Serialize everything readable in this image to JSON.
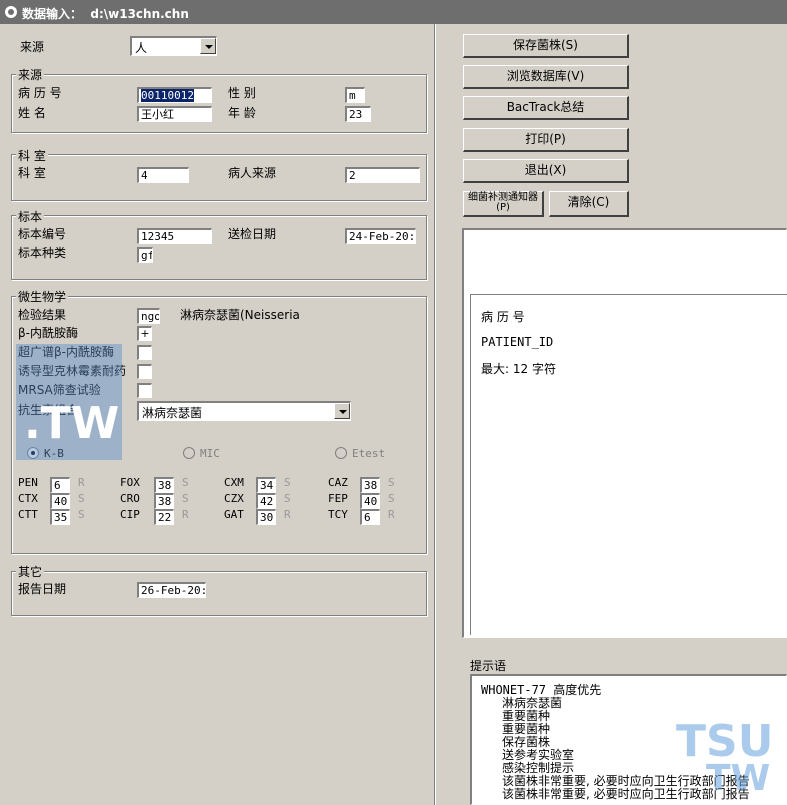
{
  "window": {
    "title": "数据输入：  d:\\w13chn.chn"
  },
  "source": {
    "label": "来源",
    "value": "人"
  },
  "patient_group": {
    "title": "来源",
    "patient_id_label": "病 历 号",
    "patient_id_value": "00110012",
    "name_label": "姓  名",
    "name_value": "王小红",
    "sex_label": "性  别",
    "sex_value": "m",
    "age_label": "年  龄",
    "age_value": "23"
  },
  "dept_group": {
    "title": "科  室",
    "dept_label": "科  室",
    "dept_value": "4",
    "origin_label": "病人来源",
    "origin_value": "2"
  },
  "specimen_group": {
    "title": "标本",
    "number_label": "标本编号",
    "number_value": "12345",
    "date_label": "送检日期",
    "date_value": "24-Feb-20:",
    "type_label": "标本种类",
    "type_value": "gf"
  },
  "micro_group": {
    "title": "微生物学",
    "result_label": "检验结果",
    "result_value": "ngo",
    "result_name": "淋病奈瑟菌(Neisseria",
    "beta_label": "β-内酰胺酶",
    "beta_value": "+",
    "esbl_label": "超广谱β-内酰胺酶",
    "induced_label": "诱导型克林霉素耐药",
    "mrsa_label": "MRSA筛查试验",
    "panel_label": "抗生素组合",
    "panel_value": "淋病奈瑟菌",
    "radio_kb": "K-B",
    "radio_mic": "MIC",
    "radio_etest": "Etest"
  },
  "antibiotics": [
    {
      "code": "PEN",
      "value": "6",
      "interp": "R"
    },
    {
      "code": "FOX",
      "value": "38",
      "interp": "S"
    },
    {
      "code": "CXM",
      "value": "34",
      "interp": "S"
    },
    {
      "code": "CAZ",
      "value": "38",
      "interp": "S"
    },
    {
      "code": "CTX",
      "value": "40",
      "interp": "S"
    },
    {
      "code": "CRO",
      "value": "38",
      "interp": "S"
    },
    {
      "code": "CZX",
      "value": "42",
      "interp": "S"
    },
    {
      "code": "FEP",
      "value": "40",
      "interp": "S"
    },
    {
      "code": "CTT",
      "value": "35",
      "interp": "S"
    },
    {
      "code": "CIP",
      "value": "22",
      "interp": "R"
    },
    {
      "code": "GAT",
      "value": "30",
      "interp": "R"
    },
    {
      "code": "TCY",
      "value": "6",
      "interp": "R"
    }
  ],
  "other_group": {
    "title": "其它",
    "report_label": "报告日期",
    "report_value": "26-Feb-20:"
  },
  "buttons": {
    "save": "保存菌株(S)",
    "browse": "浏览数据库(V)",
    "bactrack": "BacTrack总结",
    "print": "打印(P)",
    "exit": "退出(X)",
    "isolate_alert": "细菌补测通知器(P)",
    "clear": "清除(C)"
  },
  "info_panel": {
    "field": "病 历 号",
    "code": "PATIENT_ID",
    "max": "最大:  12 字符"
  },
  "hints": {
    "label": "提示语",
    "header": "WHONET-77     高度优先",
    "lines": [
      "淋病奈瑟菌",
      "重要菌种",
      "重要菌种",
      "保存菌株",
      "送参考实验室",
      "感染控制提示",
      "该菌株非常重要, 必要时应向卫生行政部门报告",
      "该菌株非常重要, 必要时应向卫生行政部门报告"
    ]
  },
  "watermarks": {
    "left": ".TW",
    "right_top": "TSU",
    "right_bottom": "TW"
  }
}
